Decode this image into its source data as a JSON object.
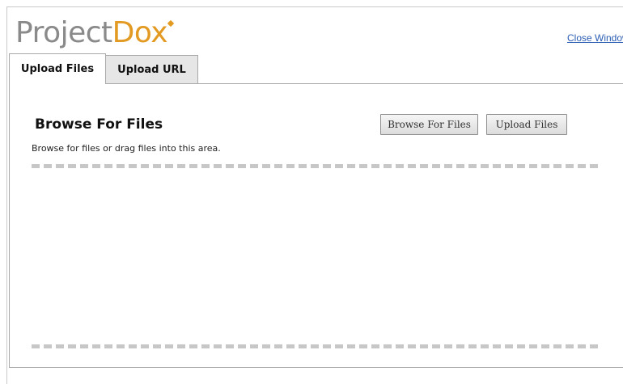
{
  "app": {
    "logo_text_primary": "Project",
    "logo_text_accent": "Dox",
    "close_link": "Close Window"
  },
  "tabs": [
    {
      "label": "Upload Files",
      "active": true
    },
    {
      "label": "Upload URL",
      "active": false
    }
  ],
  "panel": {
    "title": "Browse For Files",
    "hint": "Browse for files or drag files into this area.",
    "browse_button": "Browse For Files",
    "upload_button": "Upload Files"
  },
  "colors": {
    "logo_gray": "#8a8a8a",
    "logo_orange": "#e39a22",
    "link_blue": "#2a5cb3"
  }
}
